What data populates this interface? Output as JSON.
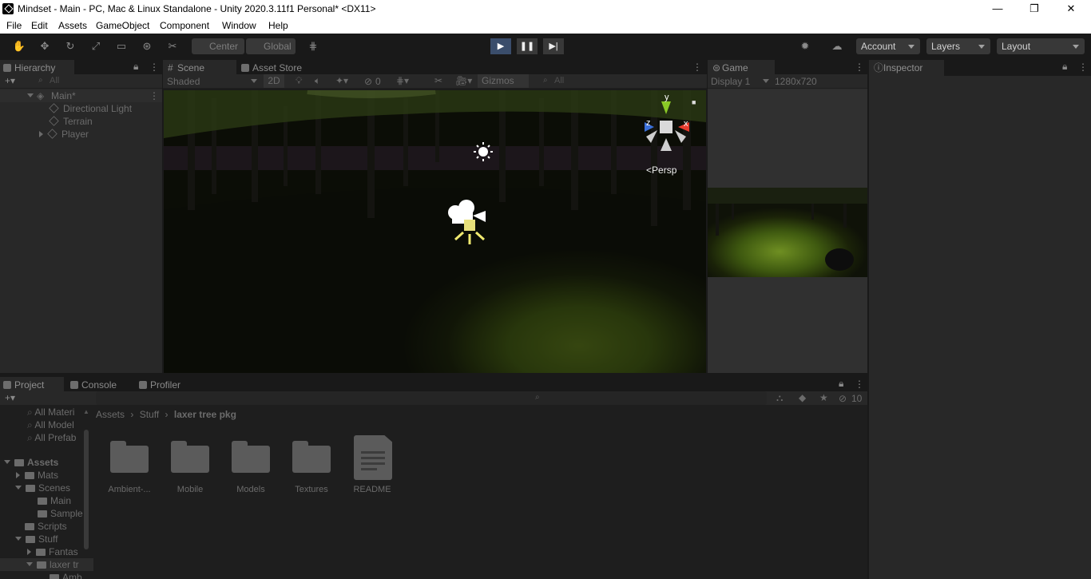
{
  "window": {
    "title": "Mindset - Main - PC, Mac & Linux Standalone - Unity 2020.3.11f1 Personal* <DX11>",
    "minimize": "—",
    "maximize": "❐",
    "close": "✕"
  },
  "menu": [
    "File",
    "Edit",
    "Assets",
    "GameObject",
    "Component",
    "Window",
    "Help"
  ],
  "toolbar": {
    "pivot": "Center",
    "space": "Global",
    "account": "Account",
    "layers": "Layers",
    "layout": "Layout",
    "play_icon": "▶",
    "pause_icon": "❚❚",
    "step_icon": "▶|"
  },
  "hierarchy": {
    "tab": "Hierarchy",
    "add": "+▾",
    "search": "All",
    "scene": "Main*",
    "items": [
      "Directional Light",
      "Terrain",
      "Player"
    ]
  },
  "scene": {
    "tabs": [
      "Scene",
      "Asset Store"
    ],
    "shading": "Shaded",
    "mode2d": "2D",
    "hidden_count": "0",
    "gizmos": "Gizmos",
    "search": "All",
    "persp": "Persp",
    "axis_x": "x",
    "axis_y": "y",
    "axis_z": "z"
  },
  "game": {
    "tab": "Game",
    "display": "Display 1",
    "resolution": "1280x720"
  },
  "inspector": {
    "tab": "Inspector"
  },
  "project": {
    "tabs": [
      "Project",
      "Console",
      "Profiler"
    ],
    "hidden_count": "10",
    "breadcrumb": [
      "Assets",
      "Stuff",
      "laxer tree pkg"
    ],
    "favorites": [
      "All Materi",
      "All Model",
      "All Prefab"
    ],
    "tree": [
      "Assets",
      "Mats",
      "Scenes",
      "Main",
      "Sample",
      "Scripts",
      "Stuff",
      "Fantas",
      "laxer tr",
      "Amb"
    ],
    "items": [
      {
        "label": "Ambient-...",
        "icon": "folder-icon"
      },
      {
        "label": "Mobile",
        "icon": "folder-icon"
      },
      {
        "label": "Models",
        "icon": "folder-icon"
      },
      {
        "label": "Textures",
        "icon": "folder-icon"
      },
      {
        "label": "README",
        "icon": "document-icon"
      }
    ]
  }
}
